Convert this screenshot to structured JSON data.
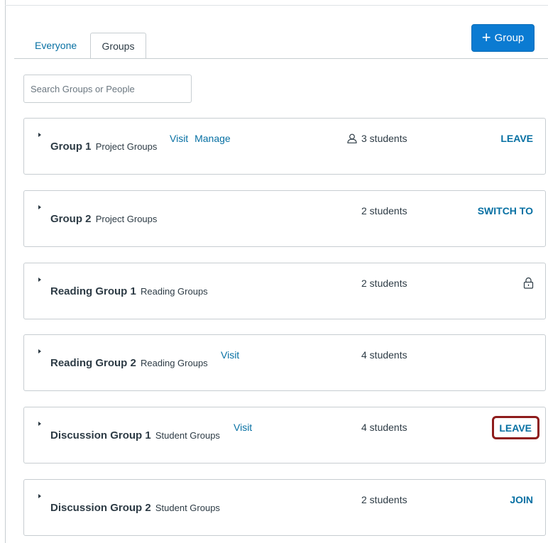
{
  "tabs": [
    {
      "label": "Everyone",
      "active": false
    },
    {
      "label": "Groups",
      "active": true
    }
  ],
  "add_group_button": {
    "plus": "+",
    "label": "Group"
  },
  "search": {
    "placeholder": "Search Groups or People",
    "value": ""
  },
  "groups": [
    {
      "name": "Group 1",
      "category": "Project Groups",
      "links": [
        "Visit",
        "Manage"
      ],
      "count": "3 students",
      "count_icon": "person-icon",
      "action": "LEAVE"
    },
    {
      "name": "Group 2",
      "category": "Project Groups",
      "links": [],
      "count": "2 students",
      "action": "SWITCH TO"
    },
    {
      "name": "Reading Group 1",
      "category": "Reading Groups",
      "links": [],
      "count": "2 students",
      "action_icon": "lock-icon"
    },
    {
      "name": "Reading Group 2",
      "category": "Reading Groups",
      "links": [
        "Visit"
      ],
      "count": "4 students"
    },
    {
      "name": "Discussion Group 1",
      "category": "Student Groups",
      "links": [
        "Visit"
      ],
      "count": "4 students",
      "action": "LEAVE",
      "highlighted": true
    },
    {
      "name": "Discussion Group 2",
      "category": "Student Groups",
      "links": [],
      "count": "2 students",
      "action": "JOIN"
    }
  ],
  "colors": {
    "link": "#0770a3",
    "button": "#0b7bd2",
    "highlight": "#8e1c1c",
    "text": "#2d3b45",
    "border": "#c7cdd1"
  }
}
